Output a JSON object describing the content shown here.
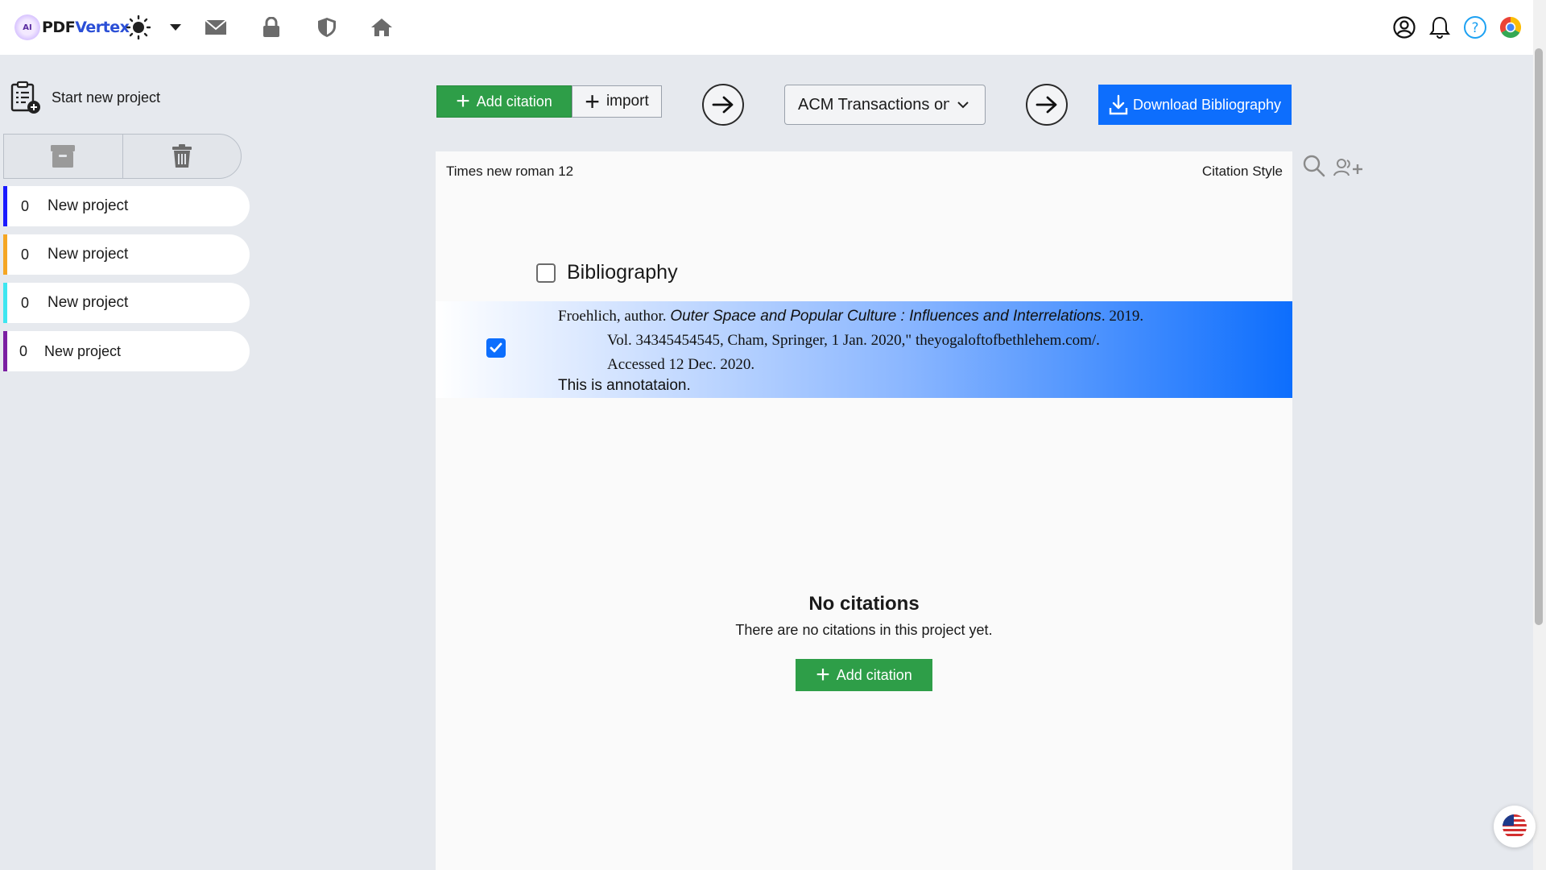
{
  "app": {
    "logo_prefix": "PDF",
    "logo_suffix": "Vertex",
    "logo_badge": "AI"
  },
  "header_icons": [
    "sun-icon",
    "caret-down-icon",
    "mail-icon",
    "lock-icon",
    "shield-icon",
    "home-icon",
    "user-circle-icon",
    "bell-icon",
    "help-icon",
    "chrome-icon"
  ],
  "sidebar": {
    "start_label": "Start new project",
    "projects": [
      {
        "count": "0",
        "name": "New project",
        "color": "#1a1aff"
      },
      {
        "count": "0",
        "name": "New project",
        "color": "#f5a623"
      },
      {
        "count": "0",
        "name": "New project",
        "color": "#3ee6f0"
      },
      {
        "count": "0",
        "name": "New project",
        "color": "#7b1fa2"
      }
    ]
  },
  "toolbar": {
    "add_citation": "Add citation",
    "import": "import",
    "citation_style": "ACM Transactions on",
    "download": "Download Bibliography"
  },
  "panel": {
    "font_label": "Times new roman 12",
    "style_label": "Citation Style",
    "bibliography_title": "Bibliography",
    "entry": {
      "line1_prefix": "Froehlich, author. ",
      "line1_title": "Outer Space and Popular Culture : Influences and Interrelations",
      "line1_suffix": ". 2019.",
      "line2": "Vol. 34345454545, Cham, Springer, 1 Jan. 2020,\" theyogaloftofbethlehem.com/.",
      "line3": "Accessed 12 Dec. 2020.",
      "annotation": "This is annotataion.",
      "checked": true
    },
    "empty_title": "No citations",
    "empty_sub": "There are no citations in this project yet.",
    "empty_button": "Add citation"
  },
  "colors": {
    "green": "#2e9e48",
    "blue": "#0d6efd"
  }
}
